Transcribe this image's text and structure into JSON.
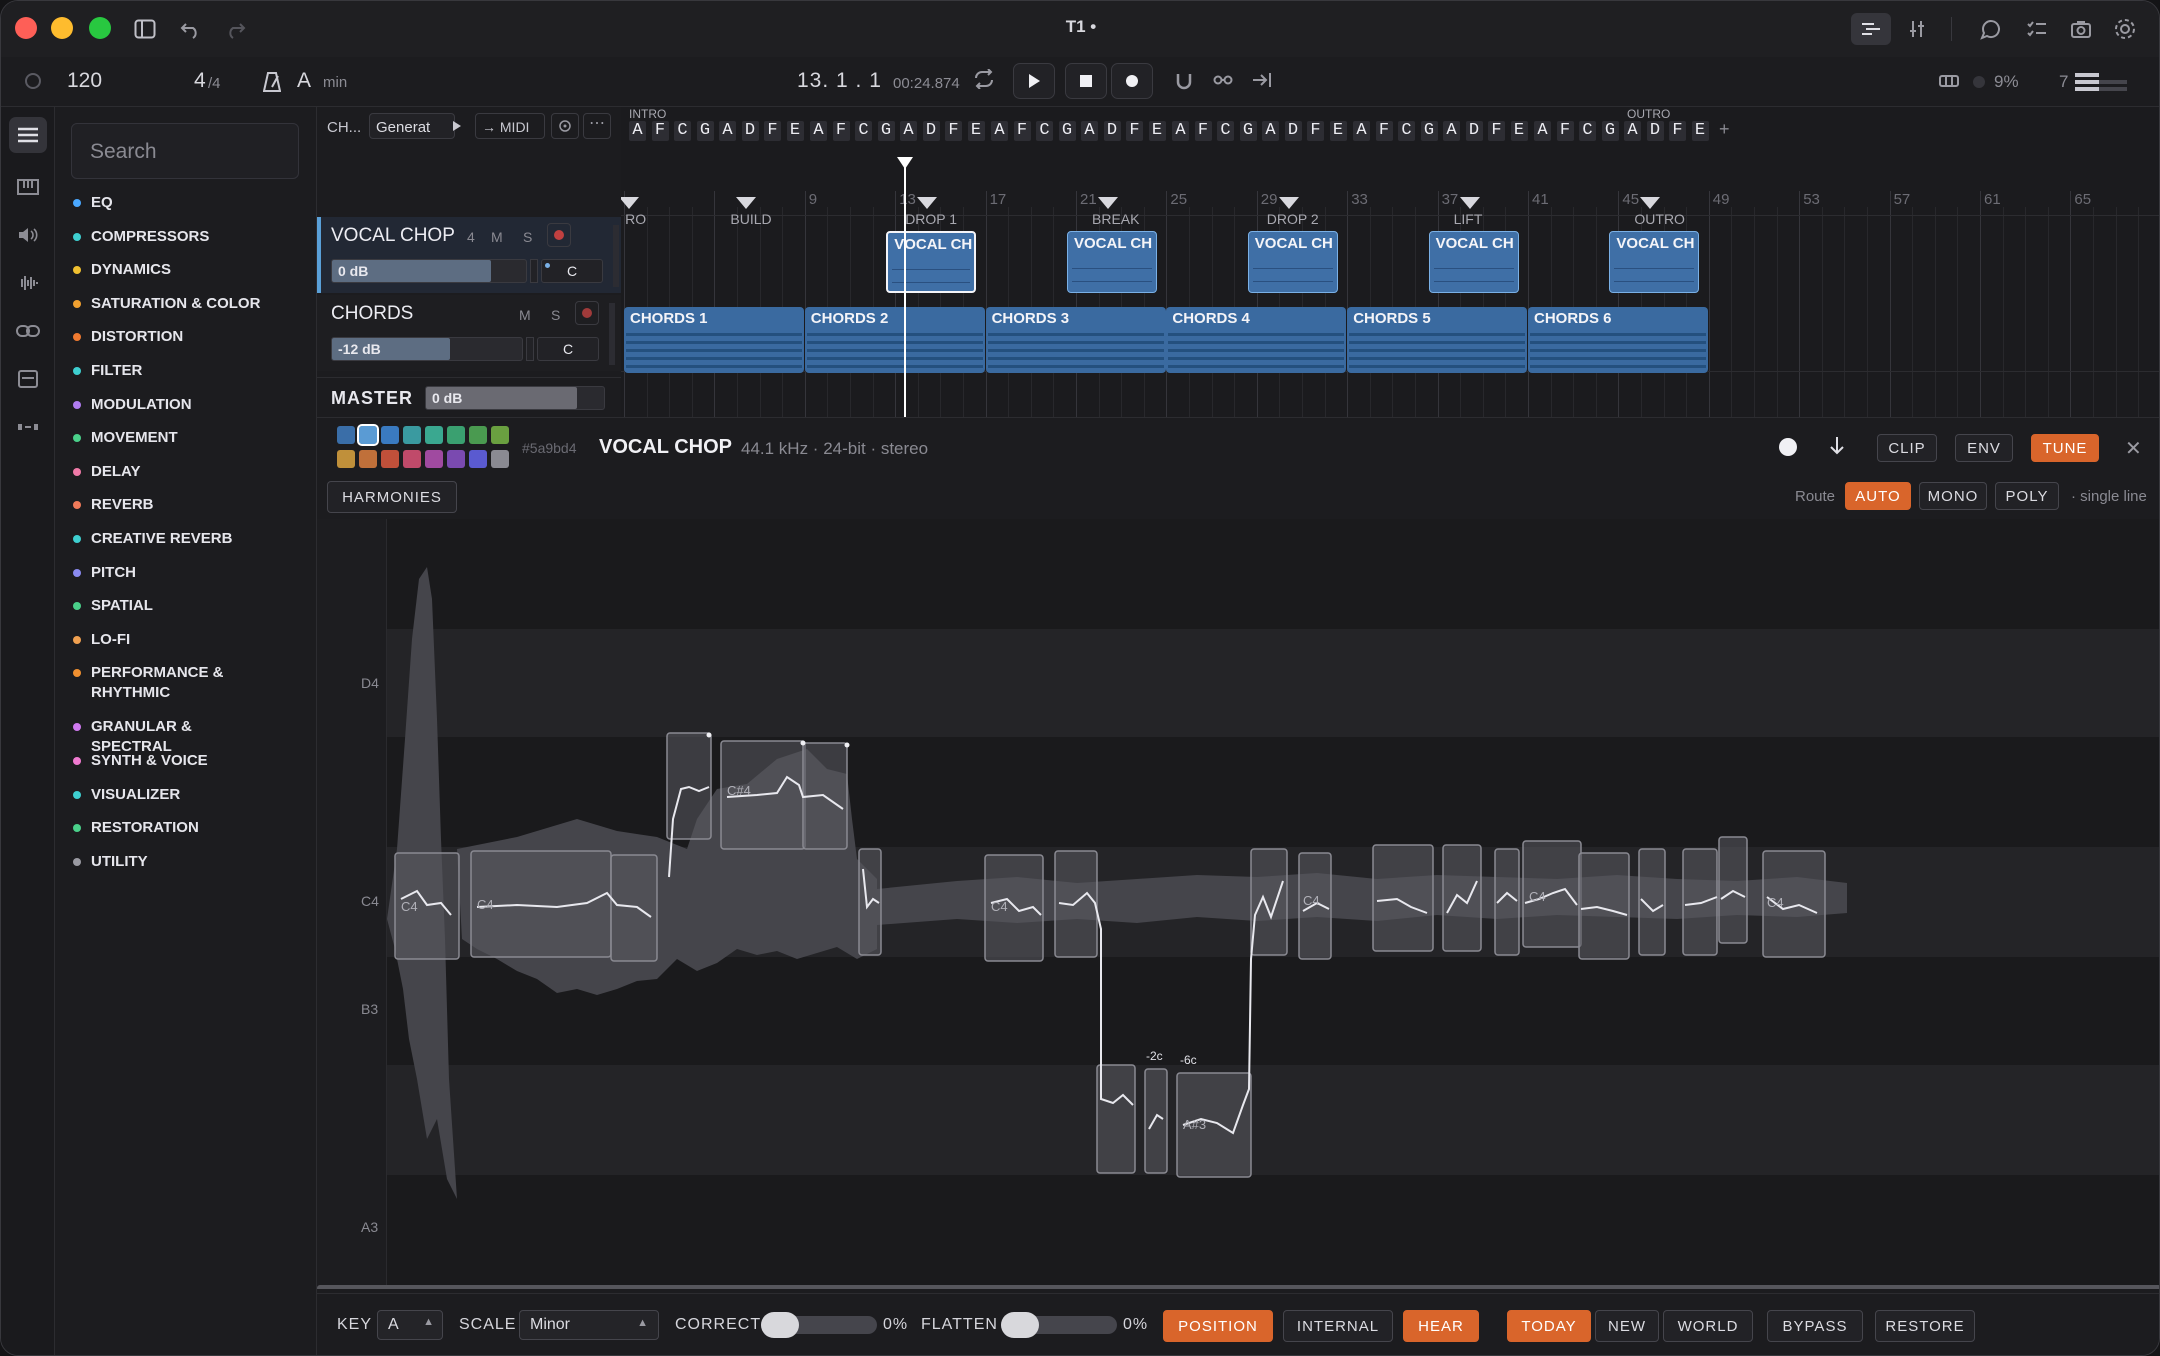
{
  "window": {
    "title": "T1 •"
  },
  "transport": {
    "tempo": "120",
    "sig_num": "4",
    "sig_den": "/4",
    "key": "A",
    "mode": "min",
    "position": "13. 1 . 1",
    "time": "00:24.874",
    "cpu": "9%",
    "voices": "7"
  },
  "browser": {
    "search_placeholder": "Search",
    "categories": [
      {
        "label": "EQ",
        "color": "#4aa8ff"
      },
      {
        "label": "COMPRESSORS",
        "color": "#3ecfd0"
      },
      {
        "label": "DYNAMICS",
        "color": "#f0c030"
      },
      {
        "label": "SATURATION & COLOR",
        "color": "#f0a030"
      },
      {
        "label": "DISTORTION",
        "color": "#f07a30"
      },
      {
        "label": "FILTER",
        "color": "#3ecfd0"
      },
      {
        "label": "MODULATION",
        "color": "#b07cf0"
      },
      {
        "label": "MOVEMENT",
        "color": "#4ad08a"
      },
      {
        "label": "DELAY",
        "color": "#f07aa8"
      },
      {
        "label": "REVERB",
        "color": "#f07a5a"
      },
      {
        "label": "CREATIVE REVERB",
        "color": "#3ecfd0"
      },
      {
        "label": "PITCH",
        "color": "#8a8af0"
      },
      {
        "label": "SPATIAL",
        "color": "#4ad08a"
      },
      {
        "label": "LO-FI",
        "color": "#f0a050"
      },
      {
        "label": "PERFORMANCE & RHYTHMIC",
        "color": "#f09030"
      },
      {
        "label": "GRANULAR & SPECTRAL",
        "color": "#d07af0"
      },
      {
        "label": "SYNTH & VOICE",
        "color": "#f07ad0"
      },
      {
        "label": "VISUALIZER",
        "color": "#3ecfd0"
      },
      {
        "label": "RESTORATION",
        "color": "#4ad08a"
      },
      {
        "label": "UTILITY",
        "color": "#9a9aa2"
      }
    ]
  },
  "track_toolbar": {
    "ch": "CH...",
    "generator": "Generat",
    "midi": "→ MIDI"
  },
  "tracks": [
    {
      "name": "VOCAL CHOP",
      "number": "4",
      "mute": "M",
      "solo": "S",
      "volume": "0 dB",
      "pan": "C",
      "level": 0.82
    },
    {
      "name": "CHORDS",
      "number": "",
      "mute": "M",
      "solo": "S",
      "volume": "-12 dB",
      "pan": "C",
      "level": 0.62
    }
  ],
  "master": {
    "name": "MASTER",
    "volume": "0 dB",
    "level": 0.85
  },
  "arrangement": {
    "chord_markers": {
      "intro": "INTRO",
      "outro": "OUTRO"
    },
    "chord_seq": [
      "A",
      "F",
      "C",
      "G",
      "A",
      "D",
      "F",
      "E",
      "A",
      "F",
      "C",
      "G",
      "A",
      "D",
      "F",
      "E",
      "A",
      "F",
      "C",
      "G",
      "A",
      "D",
      "F",
      "E",
      "A",
      "F",
      "C",
      "G",
      "A",
      "D",
      "F",
      "E",
      "A",
      "F",
      "C",
      "G",
      "A",
      "D",
      "F",
      "E",
      "A",
      "F",
      "C",
      "G",
      "A",
      "D",
      "F",
      "E"
    ],
    "add": "+",
    "bars": [
      "9",
      "13",
      "17",
      "21",
      "25",
      "29",
      "33",
      "37",
      "41",
      "45",
      "49",
      "53",
      "57",
      "61",
      "65"
    ],
    "sections": [
      {
        "label": "RO",
        "bar": 1.05
      },
      {
        "label": "BUILD",
        "bar": 5
      },
      {
        "label": "DROP 1",
        "bar": 13
      },
      {
        "label": "BREAK",
        "bar": 21
      },
      {
        "label": "DROP 2",
        "bar": 29
      },
      {
        "label": "LIFT",
        "bar": 37
      },
      {
        "label": "OUTRO",
        "bar": 45
      }
    ],
    "vocal_clips": [
      {
        "label": "VOCAL CH",
        "bar": 13
      },
      {
        "label": "VOCAL CH",
        "bar": 21
      },
      {
        "label": "VOCAL CH",
        "bar": 29
      },
      {
        "label": "VOCAL CH",
        "bar": 37
      },
      {
        "label": "VOCAL CH",
        "bar": 45
      }
    ],
    "chord_clips": [
      {
        "label": "CHORDS 1",
        "bar": 1
      },
      {
        "label": "CHORDS 2",
        "bar": 9
      },
      {
        "label": "CHORDS 3",
        "bar": 17
      },
      {
        "label": "CHORDS 4",
        "bar": 25
      },
      {
        "label": "CHORDS 5",
        "bar": 33
      },
      {
        "label": "CHORDS 6",
        "bar": 41
      }
    ],
    "playhead_bar": 13.4
  },
  "editor": {
    "swatches": [
      "#3a6ea8",
      "#5a9bd4",
      "#3a7ac0",
      "#3a9aa0",
      "#3aa890",
      "#3aa070",
      "#4a9a50",
      "#6aa040",
      "#c0903a",
      "#c0703a",
      "#c0503a",
      "#c04a6a",
      "#a04aa0",
      "#7a4ab0",
      "#5a5ad0",
      "#8a8a92"
    ],
    "hex": "#5a9bd4",
    "clip_name": "VOCAL CHOP",
    "clip_info": "44.1 kHz · 24-bit · stereo",
    "tabs": {
      "clip": "CLIP",
      "env": "ENV",
      "tune": "TUNE"
    },
    "harmonies": "HARMONIES",
    "route_label": "Route",
    "route": {
      "auto": "AUTO",
      "mono": "MONO",
      "poly": "POLY"
    },
    "single_line": "· single line",
    "pitch_labels": [
      "D4",
      "C4",
      "B3",
      "A3"
    ],
    "notes_labels": {
      "c4a": "C4",
      "c4b": "C4",
      "cs4": "C#4",
      "c4c": "C4",
      "c4d": "C4",
      "c4e": "C4",
      "c4f": "C4",
      "as3": "A#3"
    },
    "cents": {
      "a": "-2c",
      "b": "-6c"
    }
  },
  "bottom": {
    "key_label": "KEY",
    "key_value": "A",
    "scale_label": "SCALE",
    "scale_value": "Minor",
    "correct_label": "CORRECT",
    "correct_value": "0%",
    "flatten_label": "FLATTEN",
    "flatten_value": "0%",
    "buttons": {
      "position": "POSITION",
      "internal": "INTERNAL",
      "hear": "HEAR",
      "today": "TODAY",
      "new": "NEW",
      "world": "WORLD",
      "bypass": "BYPASS",
      "restore": "RESTORE"
    }
  }
}
